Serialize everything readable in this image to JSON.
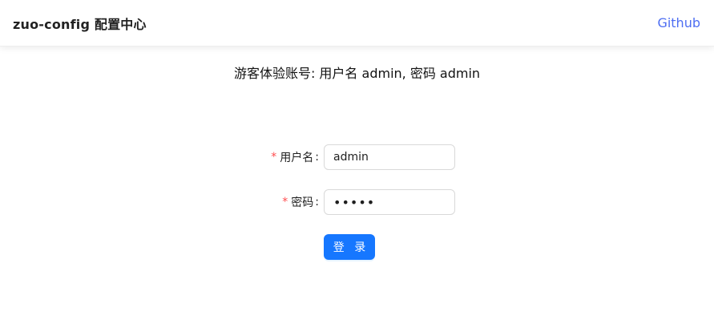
{
  "header": {
    "title": "zuo-config 配置中心",
    "github_link": "Github"
  },
  "notice": "游客体验账号: 用户名 admin, 密码 admin",
  "form": {
    "username": {
      "required_mark": "*",
      "label": "用户名",
      "colon": ":",
      "value": "admin"
    },
    "password": {
      "required_mark": "*",
      "label": "密码",
      "colon": ":",
      "value": "admin"
    },
    "submit_label": "登 录"
  },
  "colors": {
    "primary": "#1677ff",
    "link": "#4e6ef2",
    "required": "#ff4d4f"
  }
}
